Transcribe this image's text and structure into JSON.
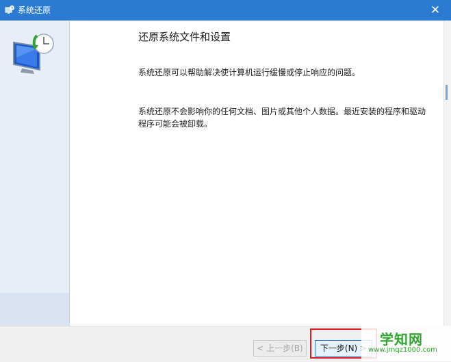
{
  "window": {
    "title": "系统还原",
    "close_glyph": "✕"
  },
  "main": {
    "heading": "还原系统文件和设置",
    "paragraph1": "系统还原可以帮助解决使计算机运行缓慢或停止响应的问题。",
    "paragraph2": "系统还原不会影响你的任何文档、图片或其他个人数据。最近安装的程序和驱动程序可能会被卸载。"
  },
  "footer": {
    "back_label": "< 上一步(B)",
    "next_label": "下一步(N) >"
  },
  "watermark": {
    "brand": "学知网",
    "url": "www.jmqz1000.com"
  },
  "colors": {
    "titlebar": "#2b7bd3",
    "highlight": "#e0191d",
    "watermark": "#2fa52f"
  },
  "icons": [
    "system-restore-icon",
    "computer-restore-icon",
    "close-icon"
  ]
}
